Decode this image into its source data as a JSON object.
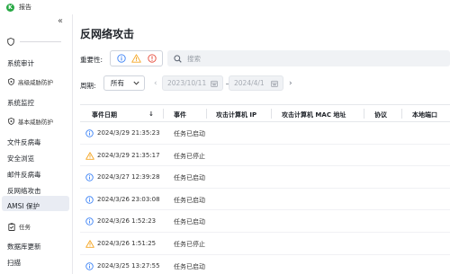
{
  "app": {
    "title": "报告",
    "logo_letter": "K"
  },
  "colors": {
    "accent": "#3b82f6",
    "warning": "#f5a623",
    "danger": "#e74c3c",
    "active_bg": "#e9ecf3",
    "logo": "#27a844"
  },
  "sidebar": {
    "collapse_icon": "double-chevron-left-icon",
    "shield_icon": "shield-icon",
    "items": [
      {
        "label": "系统审计"
      },
      {
        "label": "高级威胁防护",
        "icon": "shield-icon"
      },
      {
        "label": "系统监控"
      },
      {
        "label": "基本威胁防护",
        "icon": "shield-icon"
      },
      {
        "label": "文件反病毒"
      },
      {
        "label": "安全浏览"
      },
      {
        "label": "邮件反病毒"
      },
      {
        "label": "反网络攻击"
      },
      {
        "label": "AMSI 保护"
      },
      {
        "label": "任务",
        "icon": "clipboard-icon"
      },
      {
        "label": "数据库更新"
      },
      {
        "label": "扫描"
      }
    ]
  },
  "main": {
    "title": "反网络攻击",
    "severity_label": "重要性:",
    "search_placeholder": "搜索",
    "period_label": "周期:",
    "period_value": "所有",
    "date_from": "2023/10/11",
    "date_to": "2024/4/1",
    "columns": [
      "事件日期",
      "事件",
      "攻击计算机 IP",
      "攻击计算机 MAC 地址",
      "协议",
      "本地端口"
    ],
    "rows": [
      {
        "severity": "info",
        "date": "2024/3/29 21:35:23",
        "event": "任务已启动"
      },
      {
        "severity": "warning",
        "date": "2024/3/29 21:35:17",
        "event": "任务已停止"
      },
      {
        "severity": "info",
        "date": "2024/3/27 12:39:28",
        "event": "任务已启动"
      },
      {
        "severity": "info",
        "date": "2024/3/26 23:03:08",
        "event": "任务已启动"
      },
      {
        "severity": "info",
        "date": "2024/3/26 1:52:23",
        "event": "任务已启动"
      },
      {
        "severity": "warning",
        "date": "2024/3/26 1:51:25",
        "event": "任务已停止"
      },
      {
        "severity": "info",
        "date": "2024/3/25 13:27:55",
        "event": "任务已启动"
      }
    ]
  }
}
